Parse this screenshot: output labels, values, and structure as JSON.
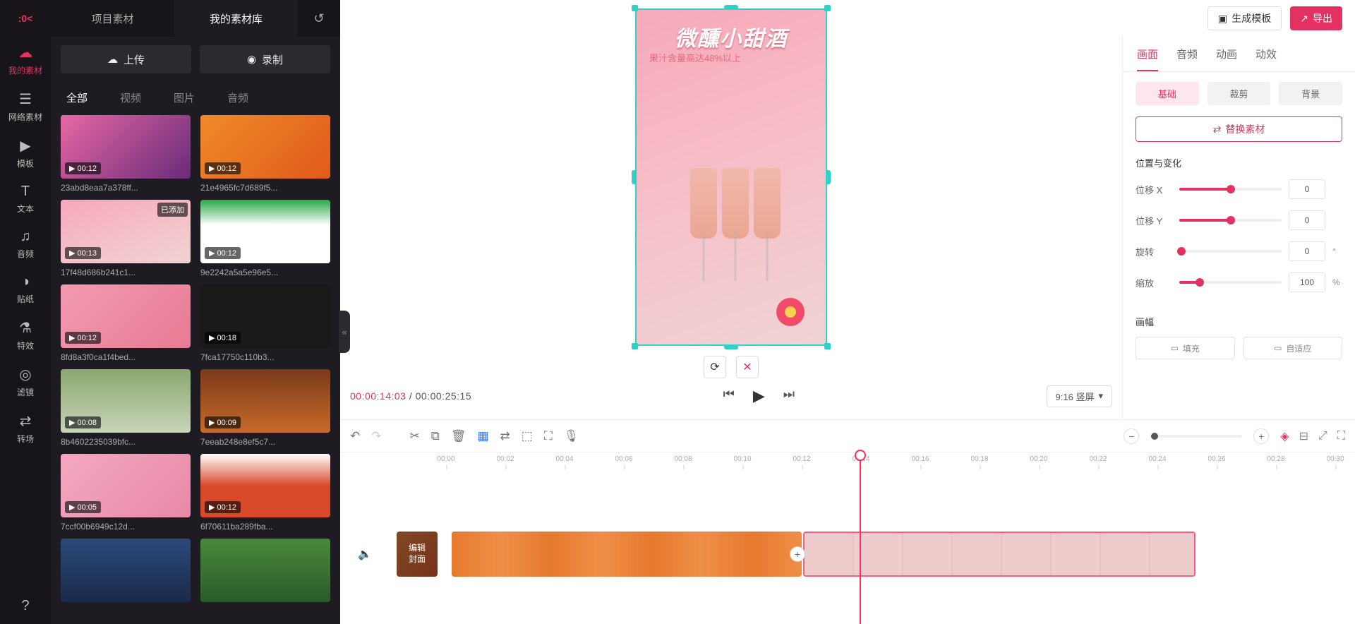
{
  "rail": {
    "items": [
      {
        "icon": "☁",
        "label": "我的素材",
        "active": true
      },
      {
        "icon": "☰",
        "label": "网络素材"
      },
      {
        "icon": "▶",
        "label": "模板"
      },
      {
        "icon": "T",
        "label": "文本"
      },
      {
        "icon": "♫",
        "label": "音频"
      },
      {
        "icon": "◑",
        "label": "贴纸"
      },
      {
        "icon": "⚗",
        "label": "特效"
      },
      {
        "icon": "◎",
        "label": "滤镜"
      },
      {
        "icon": "⇄",
        "label": "转场"
      }
    ],
    "help_icon": "?"
  },
  "media": {
    "tabs": {
      "project": "项目素材",
      "library": "我的素材库",
      "history_icon": "↺"
    },
    "upload": "上传",
    "upload_icon": "☁",
    "record": "录制",
    "record_icon": "◉",
    "filters": [
      "全部",
      "视频",
      "图片",
      "音频"
    ],
    "items": [
      {
        "dur": "00:12",
        "name": "23abd8eaa7a378ff...",
        "bg": "linear-gradient(135deg,#e668a4,#6a2b7a)"
      },
      {
        "dur": "00:12",
        "name": "21e4965fc7d689f5...",
        "bg": "linear-gradient(135deg,#f08a2a,#e05a1a)"
      },
      {
        "dur": "00:13",
        "name": "17f48d686b241c1...",
        "bg": "linear-gradient(160deg,#f7a9b9,#f0d4d4)",
        "added": "已添加"
      },
      {
        "dur": "00:12",
        "name": "9e2242a5a5e96e5...",
        "bg": "linear-gradient(#2aa84a,#ffffff 40%)"
      },
      {
        "dur": "00:12",
        "name": "8fd8a3f0ca1f4bed...",
        "bg": "linear-gradient(135deg,#f29bb0,#e87a94)"
      },
      {
        "dur": "00:18",
        "name": "7fca17750c110b3...",
        "bg": "#1a1a1a"
      },
      {
        "dur": "00:08",
        "name": "8b4602235039bfc...",
        "bg": "linear-gradient(#8aa870,#c8d4b8)"
      },
      {
        "dur": "00:09",
        "name": "7eeab248e8ef5c7...",
        "bg": "linear-gradient(#7a3a1a,#c86a2a)"
      },
      {
        "dur": "00:05",
        "name": "7ccf00b6949c12d...",
        "bg": "linear-gradient(135deg,#f4a8c0,#e888a8)"
      },
      {
        "dur": "00:12",
        "name": "6f70611ba289fba...",
        "bg": "linear-gradient(#ffffff,#d84a2a 50%)"
      },
      {
        "dur": "",
        "name": "",
        "bg": "linear-gradient(#2a4a7a,#1a2a4a)"
      },
      {
        "dur": "",
        "name": "",
        "bg": "linear-gradient(#4a8a3a,#2a5a2a)"
      }
    ]
  },
  "topbar": {
    "gen_template": "生成模板",
    "gen_icon": "▣",
    "export": "导出",
    "export_icon": "↗"
  },
  "preview": {
    "title": "微醺小甜酒",
    "subtitle": "果汁含量高达48%以上",
    "refresh_icon": "⟳",
    "delete_icon": "✕",
    "cur_time": "00:00:14:03",
    "total_time": "00:00:25:15",
    "prev_icon": "⏮",
    "play_icon": "▶",
    "next_icon": "⏭",
    "aspect": "9:16 竖屏"
  },
  "props": {
    "tabs": [
      "画面",
      "音频",
      "动画",
      "动效"
    ],
    "subtabs": [
      "基础",
      "裁剪",
      "背景"
    ],
    "replace": "替换素材",
    "replace_icon": "⇄",
    "section_pos": "位置与变化",
    "x_label": "位移 X",
    "x_val": "0",
    "y_label": "位移 Y",
    "y_val": "0",
    "rot_label": "旋转",
    "rot_val": "0",
    "rot_unit": "°",
    "scale_label": "缩放",
    "scale_val": "100",
    "scale_unit": "%",
    "section_frame": "画幅",
    "fill": "填充",
    "fit": "自适应",
    "fill_icon": "▭",
    "fit_icon": "▭"
  },
  "timeline": {
    "tools": {
      "undo": "↶",
      "redo": "↷",
      "cut": "✂",
      "copy": "⧉",
      "delete": "🗑",
      "marker": "▦",
      "swap": "⇄",
      "crop": "⬚",
      "expand": "⛶",
      "mic": "🎙"
    },
    "zoom_out": "−",
    "zoom_in": "+",
    "extra": [
      "◈",
      "⊟",
      "⤢",
      "⛶"
    ],
    "ticks": [
      "00:00",
      "00:02",
      "00:04",
      "00:06",
      "00:08",
      "00:10",
      "00:12",
      "00:14",
      "00:16",
      "00:18",
      "00:20",
      "00:22",
      "00:24",
      "00:26",
      "00:28",
      "00:30"
    ],
    "mute_icon": "🔈",
    "cover": "编辑\n封面",
    "add": "+"
  }
}
